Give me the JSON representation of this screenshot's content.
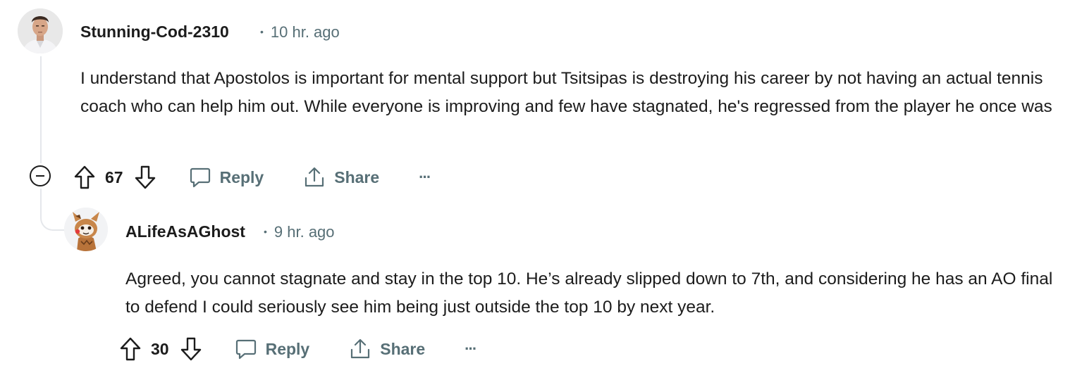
{
  "comments": [
    {
      "username": "Stunning-Cod-2310",
      "time": "10 hr. ago",
      "body": "I understand that Apostolos is important for mental support but Tsitsipas is destroying his career by not having an actual tennis coach who can help him out. While everyone is improving and few have stagnated, he's regressed from the player he once was",
      "score": "67",
      "reply_label": "Reply",
      "share_label": "Share",
      "more_label": "···"
    },
    {
      "username": "ALifeAsAGhost",
      "time": "9 hr. ago",
      "body": "Agreed, you cannot stagnate and stay in the top 10. He’s already slipped down to 7th, and considering he has an AO final to defend I could seriously see him being just outside the top 10 by next year.",
      "score": "30",
      "reply_label": "Reply",
      "share_label": "Share",
      "more_label": "···"
    }
  ],
  "meta_separator": "•",
  "colors": {
    "text": "#1c1c1c",
    "muted": "#576f76",
    "thread_line": "#e5e7eb"
  },
  "icons": {
    "collapse": "collapse-minus-icon",
    "upvote": "upvote-arrow-icon",
    "downvote": "downvote-arrow-icon",
    "reply": "comment-bubble-icon",
    "share": "share-upload-icon",
    "more": "more-dots-icon"
  }
}
